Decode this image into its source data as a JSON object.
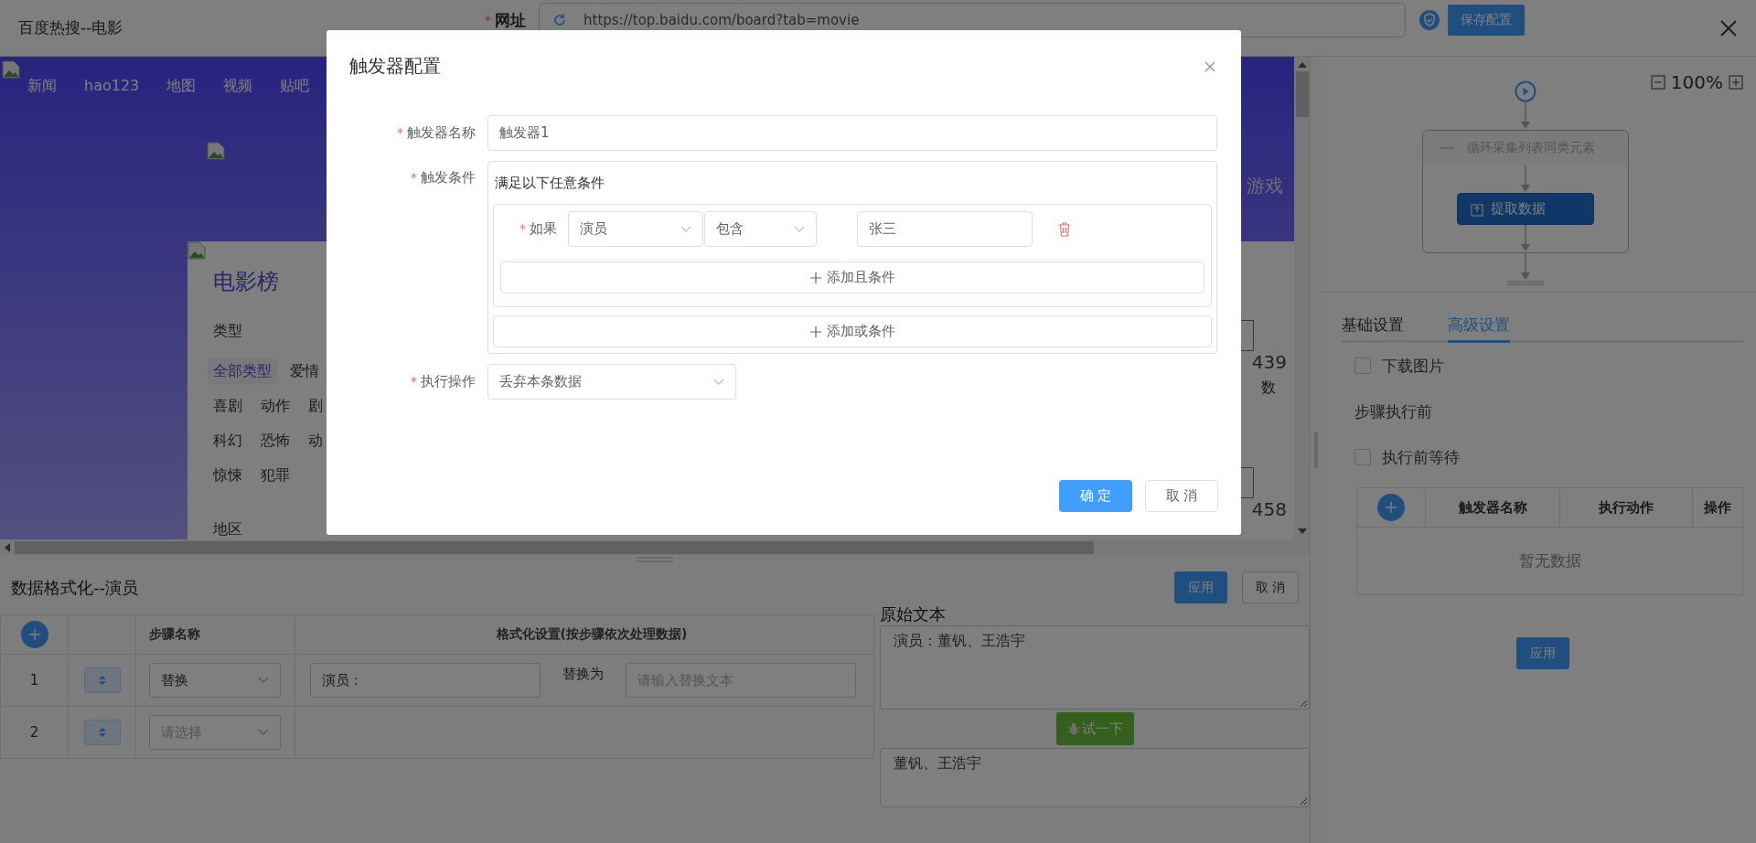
{
  "window": {
    "title": "百度热搜--电影"
  },
  "url_field": {
    "label": "网址",
    "required_mark": "*",
    "value": "https://top.baidu.com/board?tab=movie"
  },
  "save_button": "保存配置",
  "browser_view": {
    "nav": [
      "新闻",
      "hao123",
      "地图",
      "视频",
      "贴吧"
    ],
    "side_text": "游戏",
    "board": {
      "title": "电影榜",
      "type_label": "类型",
      "genres": [
        [
          {
            "label": "全部类型",
            "selected": true
          },
          {
            "label": "爱情",
            "selected": false
          }
        ],
        [
          {
            "label": "喜剧",
            "selected": false
          },
          {
            "label": "动作",
            "selected": false
          },
          {
            "label": "剧",
            "selected": false
          }
        ],
        [
          {
            "label": "科幻",
            "selected": false
          },
          {
            "label": "恐怖",
            "selected": false
          },
          {
            "label": "动",
            "selected": false
          }
        ],
        [
          {
            "label": "惊悚",
            "selected": false
          },
          {
            "label": "犯罪",
            "selected": false
          }
        ]
      ],
      "region_label": "地区"
    },
    "edge_texts": [
      "439",
      "数",
      "458"
    ]
  },
  "formatter": {
    "title": "数据格式化--演员",
    "apply": "应用",
    "cancel": "取 消",
    "columns": [
      "步骤名称",
      "格式化设置(按步骤依次处理数据)"
    ],
    "steps": [
      {
        "index": "1",
        "method": {
          "value": "替换"
        },
        "find": "演员：",
        "replace_label": "替换为",
        "replace_placeholder": "请输入替换文本"
      },
      {
        "index": "2",
        "method": {
          "placeholder": "请选择"
        }
      }
    ],
    "source_label": "原始文本",
    "source_text": "演员：董钒、王浩宇",
    "try_button": "试一下",
    "result_text": "董钒、王浩宇"
  },
  "flow": {
    "zoom": "100%",
    "loop_title": "循环采集列表同类元素",
    "step": "提取数据"
  },
  "settings": {
    "tabs": [
      {
        "label": "基础设置",
        "selected": false
      },
      {
        "label": "高级设置",
        "selected": true
      }
    ],
    "options": [
      {
        "kind": "checkbox",
        "label": "下载图片",
        "checked": false
      },
      {
        "kind": "heading",
        "label": "步骤执行前"
      },
      {
        "kind": "checkbox",
        "label": "执行前等待",
        "checked": false
      }
    ],
    "trigger_table": {
      "columns": [
        "触发器名称",
        "执行动作",
        "操作"
      ],
      "empty_text": "暂无数据"
    },
    "apply": "应用"
  },
  "modal": {
    "title": "触发器配置",
    "name_field": {
      "label": "触发器名称",
      "required_mark": "*",
      "value": "触发器1"
    },
    "condition_field": {
      "label": "触发条件",
      "required_mark": "*",
      "match_text": "满足以下任意条件",
      "conditions": [
        {
          "label": "如果",
          "required_mark": "*",
          "field": "演员",
          "operator": "包含",
          "value": "张三"
        }
      ],
      "add_and": "添加且条件",
      "add_or": "添加或条件"
    },
    "action_field": {
      "label": "执行操作",
      "required_mark": "*",
      "value": "丢弃本条数据"
    },
    "confirm": "确 定",
    "cancel": "取 消"
  }
}
